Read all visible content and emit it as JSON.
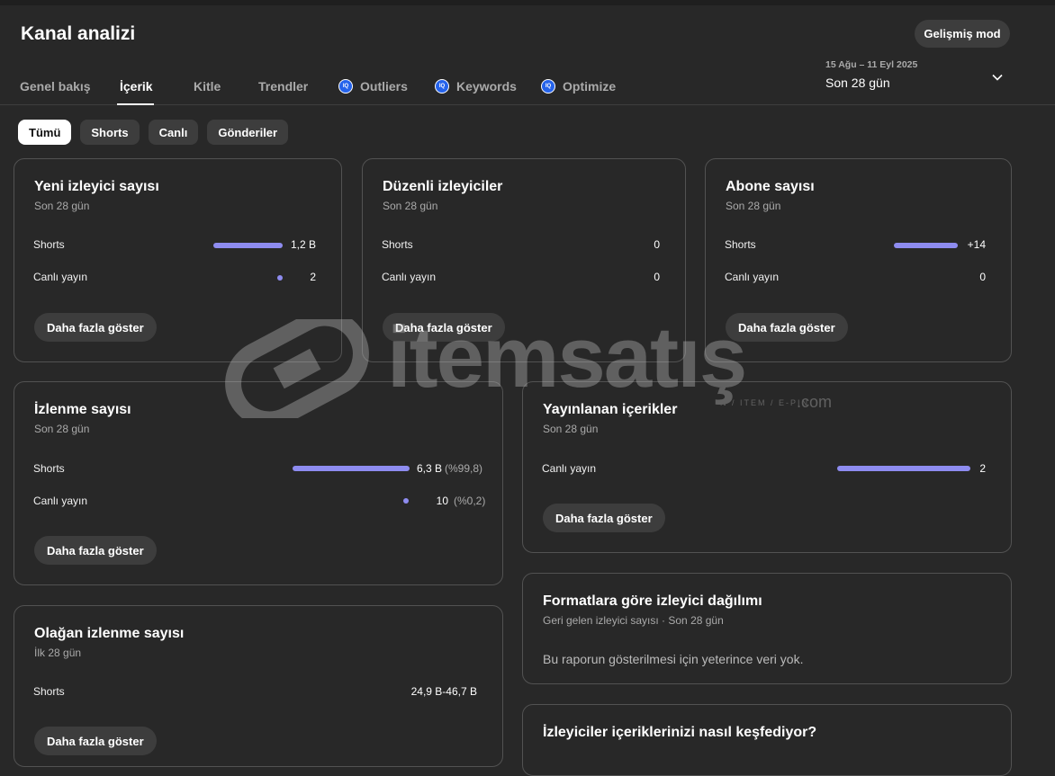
{
  "header": {
    "title": "Kanal analizi",
    "advanced_mode": "Gelişmiş mod",
    "date_range": "15 Ağu – 11 Eyl 2025",
    "date_label": "Son 28 gün"
  },
  "tabs": [
    {
      "label": "Genel bakış"
    },
    {
      "label": "İçerik"
    },
    {
      "label": "Kitle"
    },
    {
      "label": "Trendler"
    },
    {
      "label": "Outliers",
      "badge": "IQ"
    },
    {
      "label": "Keywords",
      "badge": "IQ"
    },
    {
      "label": "Optimize",
      "badge": "IQ"
    }
  ],
  "active_tab": "İçerik",
  "chips": [
    {
      "label": "Tümü"
    },
    {
      "label": "Shorts"
    },
    {
      "label": "Canlı"
    },
    {
      "label": "Gönderiler"
    }
  ],
  "cards": {
    "new_viewers": {
      "title": "Yeni izleyici sayısı",
      "subtitle": "Son 28 gün",
      "rows": [
        {
          "label": "Shorts",
          "value": "1,2 B",
          "fraction": 1.0
        },
        {
          "label": "Canlı yayın",
          "value": "2",
          "fraction": 0.0
        }
      ],
      "button": "Daha fazla göster"
    },
    "regular_viewers": {
      "title": "Düzenli izleyiciler",
      "subtitle": "Son 28 gün",
      "rows": [
        {
          "label": "Shorts",
          "value": "0"
        },
        {
          "label": "Canlı yayın",
          "value": "0"
        }
      ],
      "button": "Daha fazla göster"
    },
    "subscribers": {
      "title": "Abone sayısı",
      "subtitle": "Son 28 gün",
      "rows": [
        {
          "label": "Shorts",
          "value": "+14",
          "fraction": 1.0
        },
        {
          "label": "Canlı yayın",
          "value": "0"
        }
      ],
      "button": "Daha fazla göster"
    },
    "views": {
      "title": "İzlenme sayısı",
      "subtitle": "Son 28 gün",
      "rows": [
        {
          "label": "Shorts",
          "value": "6,3 B",
          "pct": "(%99,8)",
          "fraction": 0.998
        },
        {
          "label": "Canlı yayın",
          "value": "10",
          "pct": "(%0,2)",
          "fraction": 0.002
        }
      ],
      "button": "Daha fazla göster"
    },
    "published": {
      "title": "Yayınlanan içerikler",
      "subtitle": "Son 28 gün",
      "rows": [
        {
          "label": "Canlı yayın",
          "value": "2",
          "fraction": 1.0
        }
      ],
      "button": "Daha fazla göster"
    },
    "usual_views": {
      "title": "Olağan izlenme sayısı",
      "subtitle": "İlk 28 gün",
      "rows": [
        {
          "label": "Shorts",
          "value": "24,9 B-46,7 B"
        }
      ],
      "button": "Daha fazla göster"
    },
    "format_distribution": {
      "title": "Formatlara göre izleyici dağılımı",
      "subtitle": "Geri gelen izleyici sayısı · Son 28 gün",
      "message": "Bu raporun gösterilmesi için yeterince veri yok."
    },
    "discovery": {
      "title": "İzleyiciler içeriklerinizi nasıl keşfediyor?"
    }
  },
  "watermark": {
    "text": "itemsatış",
    "sub": "N / ITEM / E-PIN",
    "com": ".com"
  },
  "colors": {
    "accent_bar": "#8e8cf0",
    "iq_badge": "#2563eb",
    "background": "#282828"
  }
}
